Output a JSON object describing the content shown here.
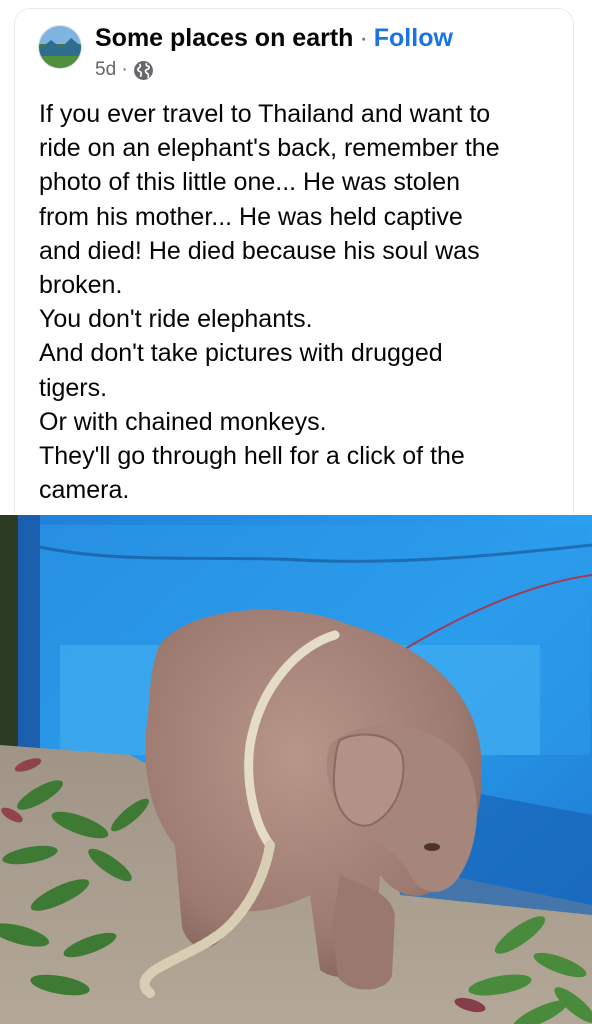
{
  "post": {
    "author": "Some places on earth",
    "separator": "·",
    "follow_label": "Follow",
    "timestamp": "5d ·",
    "privacy_icon": "globe-icon",
    "text_lines": [
      "If you ever travel to Thailand and want to",
      "ride on an elephant's back, remember the",
      "photo of this little one... He was stolen",
      "from his mother... He was held captive",
      "and died! He died because his soul was",
      "broken.",
      "You don't ride elephants.",
      "And don't take pictures with drugged",
      "tigers.",
      "Or with chained monkeys.",
      "They'll go through hell for a click of the",
      "camera."
    ]
  },
  "colors": {
    "follow": "#1b74e4",
    "meta": "#65676b",
    "text": "#050505",
    "tarp": "#1f8fe6"
  }
}
